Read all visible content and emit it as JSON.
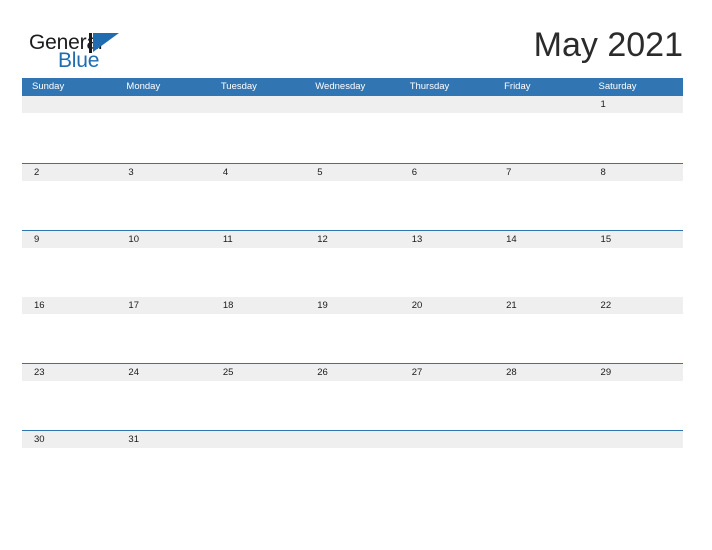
{
  "brand": {
    "name_part1": "General",
    "name_part2": "Blue",
    "flag_icon": "blue-flag-triangle",
    "colors": {
      "text_dark": "#1b1b1b",
      "blue": "#1f6cb0"
    }
  },
  "header": {
    "month_title": "May 2021"
  },
  "calendar": {
    "colors": {
      "header_blue": "#3275b3",
      "date_band_gray": "#efefef",
      "divider_blue": "#3275b3",
      "cell_white": "#ffffff"
    },
    "weekdays": [
      "Sunday",
      "Monday",
      "Tuesday",
      "Wednesday",
      "Thursday",
      "Friday",
      "Saturday"
    ],
    "weeks": [
      [
        "",
        "",
        "",
        "",
        "",
        "",
        "1"
      ],
      [
        "2",
        "3",
        "4",
        "5",
        "6",
        "7",
        "8"
      ],
      [
        "9",
        "10",
        "11",
        "12",
        "13",
        "14",
        "15"
      ],
      [
        "16",
        "17",
        "18",
        "19",
        "20",
        "21",
        "22"
      ],
      [
        "23",
        "24",
        "25",
        "26",
        "27",
        "28",
        "29"
      ],
      [
        "30",
        "31",
        "",
        "",
        "",
        "",
        ""
      ]
    ]
  }
}
